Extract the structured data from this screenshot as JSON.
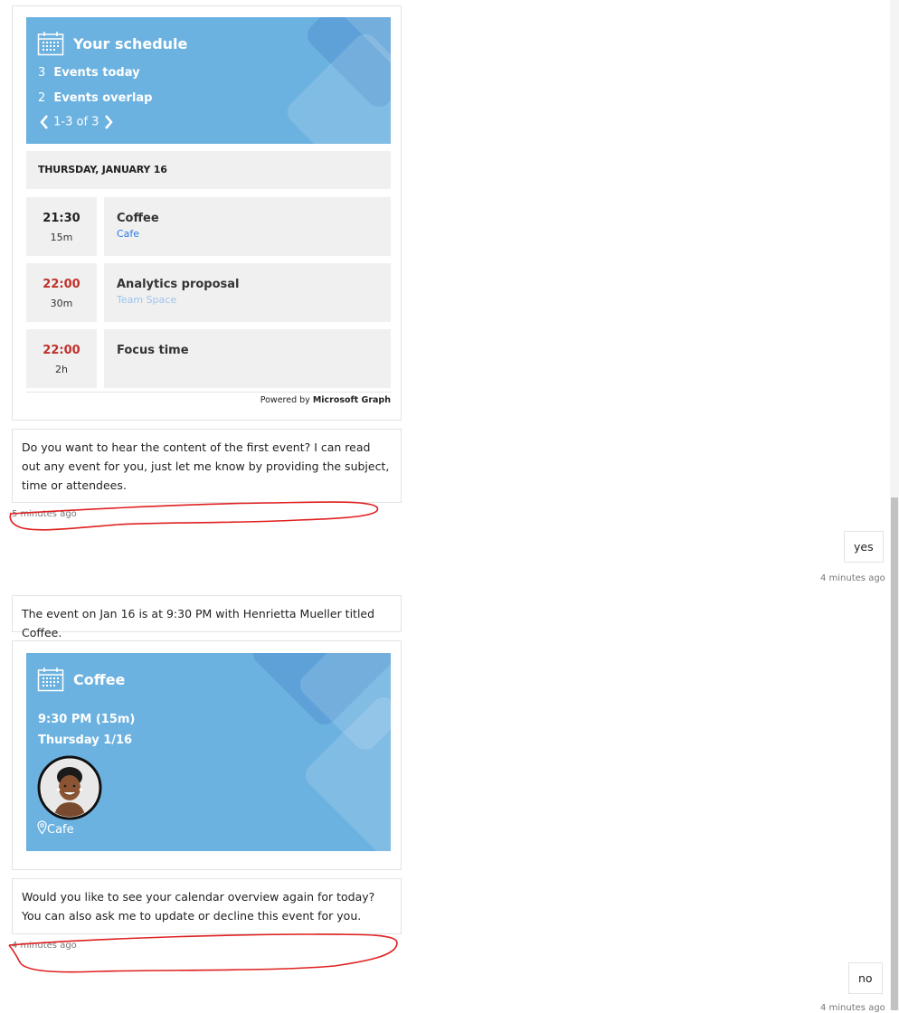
{
  "schedule_card": {
    "title": "Your schedule",
    "events_today_count": "3",
    "events_today_label": "Events today",
    "overlap_count": "2",
    "overlap_label": "Events overlap",
    "pager": "1-3 of 3",
    "date_header": "THURSDAY, JANUARY 16",
    "events": [
      {
        "time": "21:30",
        "duration": "15m",
        "subject": "Coffee",
        "location": "Cafe",
        "time_color": "#222222",
        "location_color": "#2a7be4"
      },
      {
        "time": "22:00",
        "duration": "30m",
        "subject": "Analytics proposal",
        "location": "Team Space",
        "time_color": "#c0302b",
        "location_color": "#9ec4ef"
      },
      {
        "time": "22:00",
        "duration": "2h",
        "subject": "Focus time",
        "location": "",
        "time_color": "#c0302b",
        "location_color": "#2a7be4"
      }
    ],
    "powered_by_prefix": "Powered by",
    "powered_by_brand": "Microsoft Graph"
  },
  "messages": {
    "bot_1": "Do you want to hear the content of the first event? I can read out any event for you, just let me know by providing the subject, time or attendees.",
    "bot_1_time": "5 minutes ago",
    "user_1": "yes",
    "user_1_time": "4 minutes ago",
    "bot_2": "The event on Jan 16 is at 9:30 PM with Henrietta Mueller titled Coffee.",
    "bot_3": "Would you like to see your calendar overview again for today? You can also ask me to update or decline this event for you.",
    "bot_3_time": "4 minutes ago",
    "user_2": "no",
    "user_2_time": "4 minutes ago"
  },
  "event_card": {
    "title": "Coffee",
    "time": "9:30 PM (15m)",
    "date": "Thursday 1/16",
    "location": "Cafe"
  },
  "colors": {
    "banner": "#6cb2e0",
    "annotation": "#e02020"
  }
}
